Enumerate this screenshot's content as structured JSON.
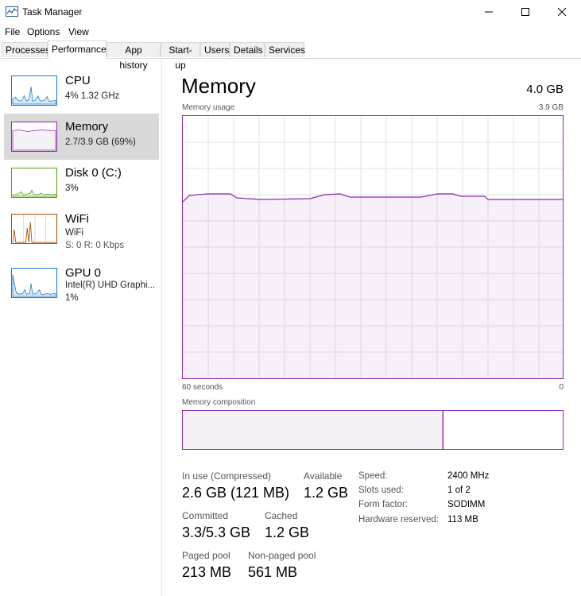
{
  "window": {
    "title": "Task Manager",
    "minimize_glyph": "—",
    "maximize_glyph": "☐",
    "close_glyph": "✕"
  },
  "menu": [
    "File",
    "Options",
    "View"
  ],
  "tabs": [
    "Processes",
    "Performance",
    "App history",
    "Start-up",
    "Users",
    "Details",
    "Services"
  ],
  "active_tab": "Performance",
  "sidebar": {
    "items": [
      {
        "title": "CPU",
        "sub1": "4%  1.32 GHz",
        "color": "#1979ca"
      },
      {
        "title": "Memory",
        "sub1": "2.7/3.9 GB (69%)",
        "color": "#8b29b0"
      },
      {
        "title": "Disk 0 (C:)",
        "sub1": "3%",
        "color": "#4da60c"
      },
      {
        "title": "WiFi",
        "sub1": "WiFi",
        "sub2": "S: 0  R: 0 Kbps",
        "color": "#a74f01"
      },
      {
        "title": "GPU 0",
        "sub1": "Intel(R) UHD Graphi...",
        "sub2": "1%",
        "color": "#1979ca"
      }
    ]
  },
  "main": {
    "title": "Memory",
    "total": "4.0 GB",
    "usage_label": "Memory usage",
    "usage_max": "3.9 GB",
    "time_label": "60 seconds",
    "time_end": "0",
    "composition_label": "Memory composition",
    "stats": {
      "in_use_label": "In use (Compressed)",
      "in_use_value": "2.6 GB (121 MB)",
      "available_label": "Available",
      "available_value": "1.2 GB",
      "committed_label": "Committed",
      "committed_value": "3.3/5.3 GB",
      "cached_label": "Cached",
      "cached_value": "1.2 GB",
      "paged_label": "Paged pool",
      "paged_value": "213 MB",
      "nonpaged_label": "Non-paged pool",
      "nonpaged_value": "561 MB"
    },
    "specs": [
      {
        "label": "Speed:",
        "value": "2400 MHz"
      },
      {
        "label": "Slots used:",
        "value": "1 of 2"
      },
      {
        "label": "Form factor:",
        "value": "SODIMM"
      },
      {
        "label": "Hardware reserved:",
        "value": "113 MB"
      }
    ]
  },
  "accent_color": "#8b29b0"
}
